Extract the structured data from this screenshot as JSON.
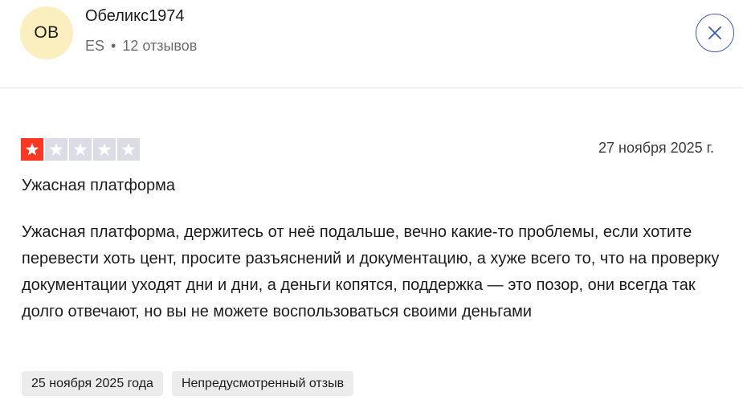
{
  "user": {
    "initials": "OB",
    "name": "Обеликс1974",
    "country": "ES",
    "separator": "•",
    "reviews_count": "12 отзывов"
  },
  "close_button": {
    "icon": "close-icon"
  },
  "review": {
    "rating": 1,
    "rating_max": 5,
    "date": "27 ноября 2025 г.",
    "title": "Ужасная платформа",
    "body": "Ужасная платформа, держитесь от неё подальше, вечно какие-то проблемы, если хотите перевести хоть цент, просите разъяснений и документацию, а хуже всего то, что на проверку документации уходят дни и дни, а деньги копятся, поддержка — это позор, они всегда так долго отвечают, но вы не можете воспользоваться своими деньгами",
    "experience_date": "25 ноября 2025 года",
    "review_type": "Непредусмотренный отзыв"
  },
  "colors": {
    "avatar_bg": "#fbefbf",
    "star_filled": "#ff3722",
    "star_empty": "#dcdce6",
    "close_accent": "#3c57bc",
    "tag_bg": "#ececec"
  }
}
